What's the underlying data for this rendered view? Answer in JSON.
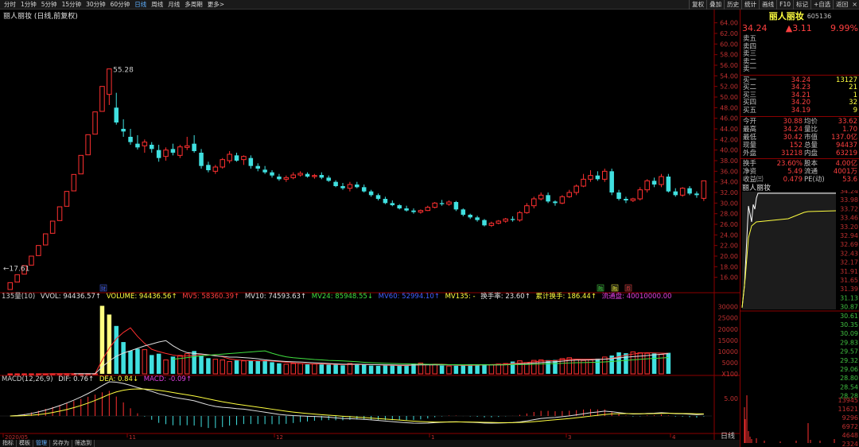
{
  "toolbar": {
    "period_tabs": [
      "分时",
      "1分钟",
      "5分钟",
      "15分钟",
      "30分钟",
      "60分钟",
      "日线",
      "周线",
      "月线",
      "多周期",
      "更多>"
    ],
    "active_tab": "日线",
    "right_buttons": [
      "复权",
      "叠加",
      "历史",
      "统计",
      "画线",
      "F10",
      "标记",
      "+自选",
      "返回"
    ],
    "close": "×"
  },
  "chart_title": "丽人丽妆 (日线,前复权)",
  "annotations": {
    "high": "55.28",
    "low": "17.61"
  },
  "volume_indicator": {
    "name": "135量(10)",
    "vvol": "VVOL: 94436.57↑",
    "volume": "VOLUME: 94436.56↑",
    "mv5": "MV5: 58360.39↑",
    "mv10": "MV10: 74593.63↑",
    "mv24": "MV24: 85948.55↓",
    "mv60": "MV60: 52994.10↑",
    "mv135": "MV135: -",
    "turnover": "换手率: 23.60↑",
    "cum_turnover": "累计换手: 186.44↑",
    "float_shares": "流通盘: 40010000.00"
  },
  "macd_indicator": {
    "name": "MACD(12,26,9)",
    "dif": "DIF: 0.76↑",
    "dea": "DEA: 0.84↓",
    "macd": "MACD: -0.09↑"
  },
  "x_axis_labels": [
    "2020/05",
    "11",
    "12",
    "1",
    "3",
    "4"
  ],
  "price_axis": [
    "64.00",
    "62.00",
    "60.00",
    "58.00",
    "56.00",
    "54.00",
    "52.00",
    "50.00",
    "48.00",
    "46.00",
    "44.00",
    "42.00",
    "40.00",
    "38.00",
    "36.00",
    "34.00",
    "32.00",
    "30.00",
    "28.00",
    "26.00",
    "24.00",
    "22.00",
    "20.00",
    "18.00",
    "16.00"
  ],
  "volume_axis": [
    "30000",
    "25000",
    "20000",
    "15000",
    "10000",
    "5000",
    "X100"
  ],
  "macd_axis": [
    "5.00"
  ],
  "event_markers": [
    "财",
    "融",
    "融",
    "券"
  ],
  "bottom_tabs": [
    "指标",
    "模板",
    "管理",
    "另存为",
    "筛选到"
  ],
  "active_bottom_tab": "管理",
  "day_label": "日线",
  "right_panel": {
    "name": "丽人丽妆",
    "code": "605136",
    "price": "34.24",
    "change": "▲3.11",
    "pct": "9.99%",
    "sell": [
      {
        "label": "卖五",
        "price": "",
        "vol": ""
      },
      {
        "label": "卖四",
        "price": "",
        "vol": ""
      },
      {
        "label": "卖三",
        "price": "",
        "vol": ""
      },
      {
        "label": "卖二",
        "price": "",
        "vol": ""
      },
      {
        "label": "卖一",
        "price": "",
        "vol": ""
      }
    ],
    "buy": [
      {
        "label": "买一",
        "price": "34.24",
        "vol": "13127"
      },
      {
        "label": "买二",
        "price": "34.23",
        "vol": "21"
      },
      {
        "label": "买三",
        "price": "34.21",
        "vol": "1"
      },
      {
        "label": "买四",
        "price": "34.20",
        "vol": "32"
      },
      {
        "label": "买五",
        "price": "34.19",
        "vol": "9"
      }
    ],
    "stats": [
      {
        "l1": "今开",
        "v1": "30.88",
        "l2": "均价",
        "v2": "33.62"
      },
      {
        "l1": "最高",
        "v1": "34.24",
        "l2": "量比",
        "v2": "1.70"
      },
      {
        "l1": "最低",
        "v1": "30.42",
        "l2": "市值",
        "v2": "137.0亿"
      },
      {
        "l1": "现量",
        "v1": "152",
        "l2": "总量",
        "v2": "94437"
      },
      {
        "l1": "外盘",
        "v1": "31218",
        "l2": "内盘",
        "v2": "63219"
      }
    ],
    "stats2": [
      {
        "l1": "换手",
        "v1": "23.60%",
        "l2": "股本",
        "v2": "4.00亿"
      },
      {
        "l1": "净资",
        "v1": "5.49",
        "l2": "流通",
        "v2": "4001万"
      },
      {
        "l1": "收益㈢",
        "v1": "0.479",
        "l2": "PE(动)",
        "v2": "53.6"
      }
    ],
    "mini_title": "丽人丽妆",
    "mini_price_axis": [
      "34.24",
      "33.98",
      "33.72",
      "33.46",
      "33.20",
      "32.94",
      "32.69",
      "32.43",
      "32.17",
      "31.91",
      "31.65",
      "31.39",
      "31.13",
      "30.87",
      "30.61",
      "30.35",
      "30.09",
      "29.83",
      "29.57",
      "29.32",
      "29.06",
      "28.80",
      "28.54",
      "28.28"
    ],
    "mini_vol_axis": [
      "13945",
      "11621",
      "9296",
      "6972",
      "4648",
      "2324"
    ]
  },
  "chart_data": {
    "type": "candlestick",
    "candles_ohlc": [
      [
        13.7,
        15.0,
        13.7,
        15.0
      ],
      [
        15.1,
        16.5,
        15.1,
        16.5
      ],
      [
        16.6,
        18.2,
        16.6,
        18.2
      ],
      [
        18.3,
        20.0,
        18.3,
        20.0
      ],
      [
        20.1,
        22.0,
        20.1,
        22.0
      ],
      [
        22.1,
        24.2,
        22.1,
        24.2
      ],
      [
        24.3,
        26.6,
        24.3,
        26.6
      ],
      [
        26.7,
        29.3,
        26.7,
        29.3
      ],
      [
        29.4,
        32.2,
        29.4,
        32.2
      ],
      [
        32.3,
        35.4,
        32.3,
        35.4
      ],
      [
        35.5,
        39.0,
        35.5,
        39.0
      ],
      [
        39.1,
        42.9,
        39.1,
        42.9
      ],
      [
        43.0,
        47.2,
        43.0,
        47.2
      ],
      [
        47.3,
        52.0,
        47.3,
        52.0
      ],
      [
        50.5,
        55.3,
        48.5,
        55.3
      ],
      [
        48.0,
        50.8,
        44.8,
        45.2
      ],
      [
        44.0,
        45.8,
        42.5,
        43.5
      ],
      [
        42.5,
        44.0,
        41.0,
        41.5
      ],
      [
        41.2,
        42.8,
        40.1,
        40.5
      ],
      [
        40.8,
        42.0,
        39.5,
        41.5
      ],
      [
        41.0,
        41.5,
        39.5,
        40.2
      ],
      [
        40.0,
        41.0,
        37.8,
        38.5
      ],
      [
        38.8,
        40.5,
        38.0,
        40.0
      ],
      [
        40.2,
        41.2,
        39.0,
        39.5
      ],
      [
        39.0,
        41.0,
        38.5,
        40.6
      ],
      [
        40.5,
        42.5,
        40.0,
        40.8
      ],
      [
        41.2,
        42.8,
        39.5,
        39.8
      ],
      [
        39.5,
        40.2,
        36.5,
        37.0
      ],
      [
        37.2,
        37.8,
        35.8,
        36.2
      ],
      [
        36.0,
        37.2,
        35.5,
        36.8
      ],
      [
        36.8,
        38.5,
        36.5,
        38.2
      ],
      [
        38.0,
        39.8,
        37.5,
        39.2
      ],
      [
        39.0,
        39.5,
        37.8,
        38.0
      ],
      [
        38.2,
        39.0,
        37.2,
        38.8
      ],
      [
        38.5,
        39.0,
        36.5,
        37.0
      ],
      [
        37.0,
        37.5,
        36.0,
        36.5
      ],
      [
        36.3,
        37.0,
        35.5,
        35.8
      ],
      [
        35.8,
        36.2,
        34.8,
        35.2
      ],
      [
        35.0,
        35.5,
        34.2,
        34.5
      ],
      [
        34.5,
        35.2,
        34.0,
        34.8
      ],
      [
        34.8,
        35.8,
        34.5,
        35.3
      ],
      [
        35.3,
        36.0,
        35.0,
        35.6
      ],
      [
        35.5,
        35.8,
        34.8,
        35.0
      ],
      [
        35.0,
        35.5,
        34.6,
        35.2
      ],
      [
        35.3,
        35.8,
        34.5,
        34.8
      ],
      [
        34.8,
        35.2,
        34.0,
        34.2
      ],
      [
        34.0,
        34.3,
        33.0,
        33.2
      ],
      [
        33.2,
        33.8,
        32.5,
        32.8
      ],
      [
        32.8,
        34.0,
        32.2,
        33.5
      ],
      [
        33.5,
        34.0,
        32.8,
        33.0
      ],
      [
        33.0,
        33.5,
        32.0,
        32.2
      ],
      [
        32.2,
        32.5,
        31.2,
        31.5
      ],
      [
        31.5,
        31.8,
        30.5,
        30.8
      ],
      [
        30.8,
        31.2,
        29.8,
        30.0
      ],
      [
        30.0,
        30.5,
        29.4,
        29.6
      ],
      [
        29.6,
        29.8,
        28.8,
        29.0
      ],
      [
        29.0,
        29.5,
        28.4,
        28.6
      ],
      [
        28.6,
        29.0,
        28.0,
        28.3
      ],
      [
        28.3,
        28.8,
        28.0,
        28.6
      ],
      [
        28.6,
        29.5,
        28.5,
        29.2
      ],
      [
        29.2,
        30.2,
        29.0,
        30.0
      ],
      [
        30.0,
        30.6,
        29.5,
        29.8
      ],
      [
        29.8,
        30.5,
        29.5,
        30.2
      ],
      [
        30.2,
        30.4,
        28.5,
        28.8
      ],
      [
        28.8,
        29.0,
        27.5,
        27.8
      ],
      [
        27.8,
        28.0,
        27.0,
        27.3
      ],
      [
        27.3,
        27.6,
        26.5,
        26.8
      ],
      [
        26.8,
        27.0,
        25.6,
        25.8
      ],
      [
        25.8,
        26.5,
        25.5,
        26.2
      ],
      [
        26.2,
        26.8,
        26.0,
        26.6
      ],
      [
        26.6,
        27.2,
        26.3,
        27.0
      ],
      [
        27.0,
        27.5,
        26.5,
        26.8
      ],
      [
        26.8,
        28.5,
        26.5,
        28.2
      ],
      [
        28.2,
        30.0,
        28.0,
        29.5
      ],
      [
        29.5,
        31.2,
        29.0,
        30.8
      ],
      [
        30.8,
        32.0,
        30.5,
        31.5
      ],
      [
        31.5,
        32.0,
        30.0,
        30.3
      ],
      [
        30.3,
        30.5,
        29.5,
        30.0
      ],
      [
        30.0,
        31.5,
        29.8,
        31.2
      ],
      [
        31.2,
        32.5,
        31.0,
        32.0
      ],
      [
        32.0,
        33.5,
        31.5,
        33.2
      ],
      [
        33.2,
        35.5,
        33.0,
        34.5
      ],
      [
        34.5,
        36.2,
        34.0,
        35.2
      ],
      [
        35.2,
        36.0,
        34.2,
        34.5
      ],
      [
        34.5,
        36.5,
        34.0,
        36.0
      ],
      [
        36.0,
        36.5,
        31.5,
        32.0
      ],
      [
        32.0,
        32.5,
        30.5,
        30.8
      ],
      [
        30.8,
        31.2,
        30.0,
        30.5
      ],
      [
        30.5,
        31.0,
        30.2,
        30.8
      ],
      [
        30.8,
        33.0,
        30.5,
        32.5
      ],
      [
        32.5,
        34.5,
        32.0,
        34.2
      ],
      [
        34.2,
        34.8,
        33.0,
        33.5
      ],
      [
        33.5,
        35.5,
        33.0,
        35.0
      ],
      [
        35.0,
        35.5,
        32.0,
        32.2
      ],
      [
        32.2,
        32.8,
        31.2,
        31.5
      ],
      [
        31.5,
        33.0,
        31.2,
        32.8
      ],
      [
        32.8,
        33.2,
        31.5,
        31.8
      ],
      [
        31.8,
        32.2,
        31.0,
        31.5
      ],
      [
        30.9,
        34.2,
        30.4,
        34.2
      ]
    ],
    "volume": [
      6,
      9,
      12,
      18,
      24,
      30,
      35,
      40,
      45,
      50,
      55,
      60,
      58,
      30400,
      26500,
      21400,
      14200,
      10300,
      11200,
      10800,
      8400,
      9000,
      6200,
      7700,
      8200,
      9000,
      10200,
      8200,
      7000,
      6500,
      6200,
      5500,
      6000,
      5800,
      6000,
      5800,
      5700,
      5200,
      4700,
      4300,
      4600,
      4600,
      4200,
      4400,
      4300,
      4100,
      4100,
      3800,
      4600,
      4200,
      4100,
      3700,
      3600,
      3800,
      3800,
      3600,
      3700,
      4600,
      4800,
      4200,
      4300,
      3700,
      3500,
      3600,
      3700,
      4300,
      4200,
      4300,
      4100,
      4400,
      4600,
      5500,
      5800,
      5000,
      6000,
      6200,
      6100,
      6200,
      6800,
      7200,
      6500,
      6000,
      6200,
      6800,
      7500,
      8200,
      9600,
      9200,
      9800,
      9400,
      9200,
      9100,
      8700,
      9400
    ],
    "macd_dif": "0.76",
    "macd_dea": "0.84",
    "macd_value": "-0.09"
  }
}
